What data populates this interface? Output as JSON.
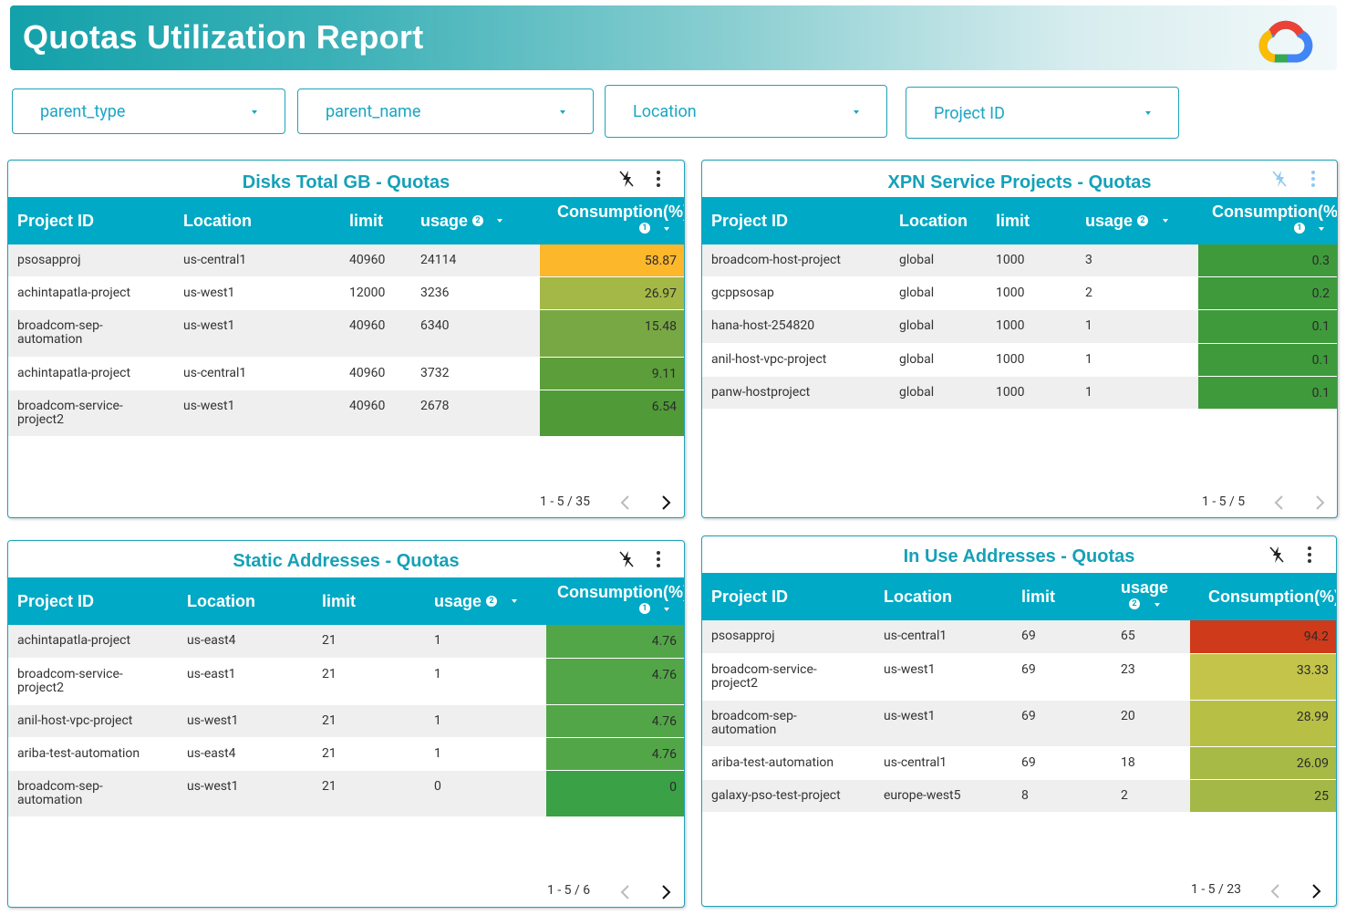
{
  "header": {
    "title": "Quotas Utilization Report",
    "logo_icon": "google-cloud-logo"
  },
  "filters": [
    {
      "label": "parent_type"
    },
    {
      "label": "parent_name"
    },
    {
      "label": "Location"
    },
    {
      "label": "Project ID"
    }
  ],
  "colors": {
    "accent": "#00a9c5",
    "title": "#15a1b8"
  },
  "panels": [
    {
      "title": "Disks Total GB - Quotas",
      "columns": [
        "Project ID",
        "Location",
        "limit",
        "usage",
        "Consumption(%)"
      ],
      "usage_help": "2",
      "cons_help": "1",
      "rows": [
        {
          "project": "psosapproj",
          "location": "us-central1",
          "limit": "40960",
          "usage": "24114",
          "consumption": "58.87",
          "color": "#fdb72b"
        },
        {
          "project": "achintapatla-project",
          "location": "us-west1",
          "limit": "12000",
          "usage": "3236",
          "consumption": "26.97",
          "color": "#a3b846"
        },
        {
          "project": "broadcom-sep-automation",
          "location": "us-west1",
          "limit": "40960",
          "usage": "6340",
          "consumption": "15.48",
          "color": "#78a844"
        },
        {
          "project": "achintapatla-project",
          "location": "us-central1",
          "limit": "40960",
          "usage": "3732",
          "consumption": "9.11",
          "color": "#5b9e3a"
        },
        {
          "project": "broadcom-service-project2",
          "location": "us-west1",
          "limit": "40960",
          "usage": "2678",
          "consumption": "6.54",
          "color": "#509a38"
        }
      ],
      "pager": "1 - 5 / 35"
    },
    {
      "title": "XPN Service Projects - Quotas",
      "columns": [
        "Project ID",
        "Location",
        "limit",
        "usage",
        "Consumption(%)"
      ],
      "usage_help": "2",
      "cons_help": "1",
      "rows": [
        {
          "project": "broadcom-host-project",
          "location": "global",
          "limit": "1000",
          "usage": "3",
          "consumption": "0.3",
          "color": "#3f9a3c"
        },
        {
          "project": "gcppsosap",
          "location": "global",
          "limit": "1000",
          "usage": "2",
          "consumption": "0.2",
          "color": "#3f9a3c"
        },
        {
          "project": "hana-host-254820",
          "location": "global",
          "limit": "1000",
          "usage": "1",
          "consumption": "0.1",
          "color": "#3f9a3c"
        },
        {
          "project": "anil-host-vpc-project",
          "location": "global",
          "limit": "1000",
          "usage": "1",
          "consumption": "0.1",
          "color": "#3f9a3c"
        },
        {
          "project": "panw-hostproject",
          "location": "global",
          "limit": "1000",
          "usage": "1",
          "consumption": "0.1",
          "color": "#3f9a3c"
        }
      ],
      "pager": "1 - 5 / 5"
    },
    {
      "title": "Static Addresses - Quotas",
      "columns": [
        "Project ID",
        "Location",
        "limit",
        "usage",
        "Consumption(%)"
      ],
      "usage_help": "2",
      "cons_help": "1",
      "rows": [
        {
          "project": "achintapatla-project",
          "location": "us-east4",
          "limit": "21",
          "usage": "1",
          "consumption": "4.76",
          "color": "#52a648"
        },
        {
          "project": "broadcom-service-project2",
          "location": "us-east1",
          "limit": "21",
          "usage": "1",
          "consumption": "4.76",
          "color": "#52a648"
        },
        {
          "project": "anil-host-vpc-project",
          "location": "us-west1",
          "limit": "21",
          "usage": "1",
          "consumption": "4.76",
          "color": "#52a648"
        },
        {
          "project": "ariba-test-automation",
          "location": "us-east4",
          "limit": "21",
          "usage": "1",
          "consumption": "4.76",
          "color": "#52a648"
        },
        {
          "project": "broadcom-sep-automation",
          "location": "us-west1",
          "limit": "21",
          "usage": "0",
          "consumption": "0",
          "color": "#3aa146"
        }
      ],
      "pager": "1 - 5 / 6"
    },
    {
      "title": "In Use Addresses - Quotas",
      "columns": [
        "Project ID",
        "Location",
        "limit",
        "usage",
        "Consumption(%)"
      ],
      "usage_help": "2",
      "rows": [
        {
          "project": "psosapproj",
          "location": "us-central1",
          "limit": "69",
          "usage": "65",
          "consumption": "94.2",
          "color": "#cf3a1b"
        },
        {
          "project": "broadcom-service-project2",
          "location": "us-west1",
          "limit": "69",
          "usage": "23",
          "consumption": "33.33",
          "color": "#c4c44a"
        },
        {
          "project": "broadcom-sep-automation",
          "location": "us-west1",
          "limit": "69",
          "usage": "20",
          "consumption": "28.99",
          "color": "#b8bf45"
        },
        {
          "project": "ariba-test-automation",
          "location": "us-central1",
          "limit": "69",
          "usage": "18",
          "consumption": "26.09",
          "color": "#a7ba45"
        },
        {
          "project": "galaxy-pso-test-project",
          "location": "europe-west5",
          "limit": "8",
          "usage": "2",
          "consumption": "25",
          "color": "#a3b846"
        }
      ],
      "pager": "1 - 5 / 23"
    }
  ]
}
